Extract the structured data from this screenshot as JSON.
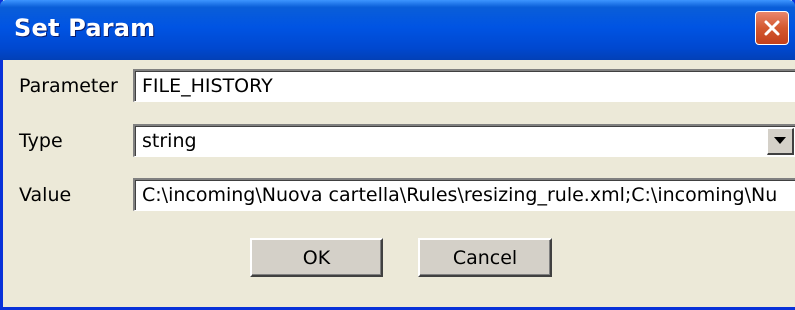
{
  "window": {
    "title": "Set Param",
    "close_icon": "close-x-icon"
  },
  "form": {
    "parameter_label": "Parameter",
    "parameter_value": "FILE_HISTORY",
    "type_label": "Type",
    "type_value": "string",
    "type_icon": "dropdown-arrow-icon",
    "value_label": "Value",
    "value_value": "C:\\incoming\\Nuova cartella\\Rules\\resizing_rule.xml;C:\\incoming\\Nu"
  },
  "buttons": {
    "ok_label": "OK",
    "cancel_label": "Cancel"
  },
  "colors": {
    "title_bar": "#0054e3",
    "client_bg": "#ece9d8",
    "close_button": "#d4582f"
  }
}
